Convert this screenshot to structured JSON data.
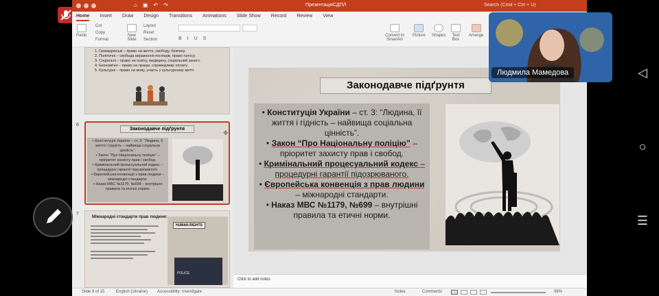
{
  "window": {
    "title": "ПрезентаціяСДПЛ",
    "search_placeholder": "Search (Cmd + Ctrl + U)"
  },
  "ribbon_tabs": [
    "Home",
    "Insert",
    "Draw",
    "Design",
    "Transitions",
    "Animations",
    "Slide Show",
    "Record",
    "Review",
    "View"
  ],
  "ribbon": {
    "paste": "Paste",
    "cut": "Cut",
    "copy": "Copy",
    "format": "Format",
    "new_slide": "New Slide",
    "layout": "Layout",
    "reset": "Reset",
    "section": "Section",
    "convert": "Convert to SmartArt",
    "picture": "Picture",
    "shapes": "Shapes",
    "textbox": "Text Box",
    "arrange": "Arrange"
  },
  "thumbnails": {
    "prev_slide_lines": [
      "1. Громадянські – право на життя, свободу, безпеку.",
      "2. Політичні – свобода вираження поглядів, право голосу.",
      "3. Соціальні – право на освіту, медицину, соціальний захист.",
      "4. Економічні – право на працю, справедливу оплату.",
      "5. Культурні – право на мову, участь у культурному житті."
    ],
    "slide6_num": "6",
    "slide6_title": "Законодавче підґрунтя",
    "slide6_lines": [
      "• Конституція України – ст. 3: \"Людина, її життя і гідність – найвища соціальна цінність\".",
      "• Закон \"Про Національну поліцію\" – пріоритет захисту прав і свобод.",
      "• Кримінальний процесуальний кодекс – процедурні гарантії підозрюваного.",
      "• Європейська конвенція з прав людини – міжнародні стандарти.",
      "• Наказ МВС №1179, №699 – внутрішні правила та етичні норми."
    ],
    "slide7_num": "7",
    "slide7_title": "Міжнародні стандарти прав людини:",
    "slide7_badge": "HUMAN RIGHTS",
    "slide7_police": "POLICE"
  },
  "slide": {
    "title": "Законодавче підґрунтя",
    "b1_bold": "Конституція України",
    "b1_rest": " – ст. 3: “Людина, її життя і гідність – найвища соціальна цінність”.",
    "b2_bold": "Закон “Про Національну поліцію”",
    "b2_rest": " – пріоритет захисту прав і свобод.",
    "b3_bold": "Кримінальний процесуальний кодекс",
    "b3_rest": " – процедурні гарантії підозрюваного.",
    "b4_bold": "Європейська конвенція з прав людини",
    "b4_rest": " – міжнародні стандарти.",
    "b5_bold": "Наказ МВС №1179, №699",
    "b5_rest": " – внутрішні правила та етичні норми."
  },
  "notes_placeholder": "Click to add notes",
  "status": {
    "slide_counter": "Slide 6 of 15",
    "language": "English (Ukraine)",
    "accessibility": "Accessibility: Investigate",
    "notes": "Notes",
    "comments": "Comments",
    "zoom": "98%"
  },
  "webcam": {
    "name": "Людмила Мамедова"
  },
  "colors": {
    "accent": "#c43e1c"
  }
}
